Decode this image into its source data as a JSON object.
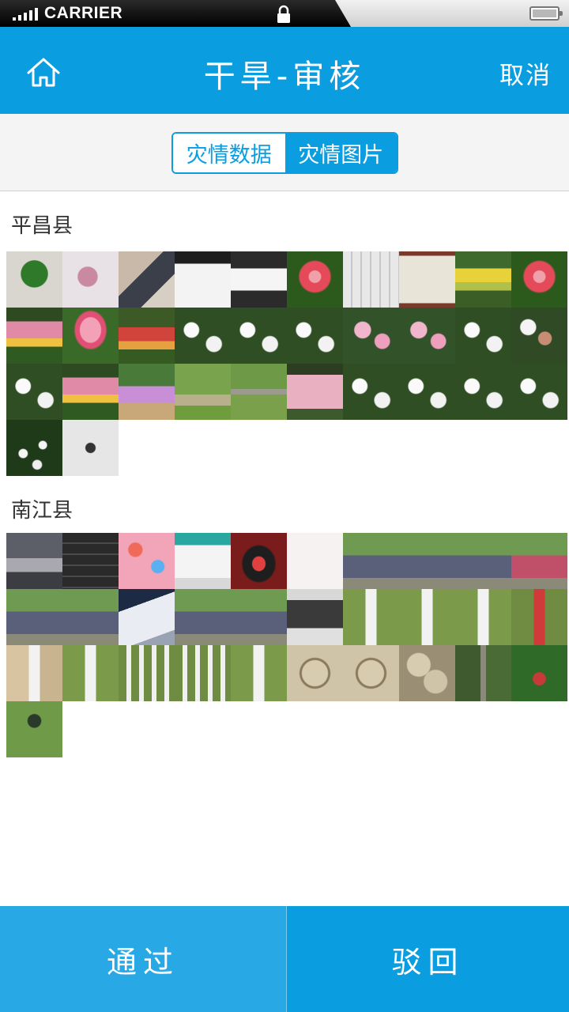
{
  "status_bar": {
    "carrier": "CARRIER"
  },
  "nav": {
    "title": "干旱-审核",
    "cancel_label": "取消"
  },
  "tabs": [
    {
      "label": "灾情数据",
      "active": false
    },
    {
      "label": "灾情图片",
      "active": true
    }
  ],
  "sections": [
    {
      "county": "平昌县",
      "photos": [
        "potted-plant",
        "person-indoor",
        "person-sitting",
        "phone-screen-app",
        "phone-screen-menu",
        "red-tulip",
        "keyboard-screen",
        "wall-map",
        "tulip-field-yellow",
        "red-tulip",
        "tulip-field-pink",
        "pink-tulip",
        "tulip-field-red",
        "white-lilies",
        "white-lilies",
        "white-lilies",
        "pink-lilies",
        "pink-lilies",
        "white-lilies",
        "hand-flowers",
        "white-lilies",
        "tulip-field-pink",
        "flower-bed",
        "park-path",
        "park-people",
        "pink-flower-bed",
        "white-lilies",
        "white-lilies",
        "white-lilies",
        "white-lilies",
        "white-flowers-dark",
        "calligraphy-paper"
      ]
    },
    {
      "county": "南江县",
      "photos": [
        "sky-landscape",
        "phone-chat-screen",
        "phone-home-screen",
        "business-card",
        "scale-display",
        "handwritten-note",
        "group-photo",
        "group-photo",
        "group-photo",
        "group-photo-red",
        "group-photo",
        "group-photo",
        "paper-document",
        "group-photo",
        "group-photo",
        "document-scan",
        "sign-on-grass",
        "sign-on-grass",
        "sign-on-grass",
        "red-sign-grass",
        "sign-on-sand",
        "sign-on-grass",
        "signs-on-grass",
        "signs-on-grass",
        "sign-on-grass",
        "coin-closeup",
        "coin-closeup",
        "coins",
        "tree-pole",
        "garden-shrubs",
        "garden-lamp"
      ]
    }
  ],
  "bottom": {
    "approve_label": "通过",
    "reject_label": "驳回"
  },
  "colors": {
    "primary": "#0a9de0",
    "approve": "#29a8e6",
    "background": "#f4f4f4"
  }
}
